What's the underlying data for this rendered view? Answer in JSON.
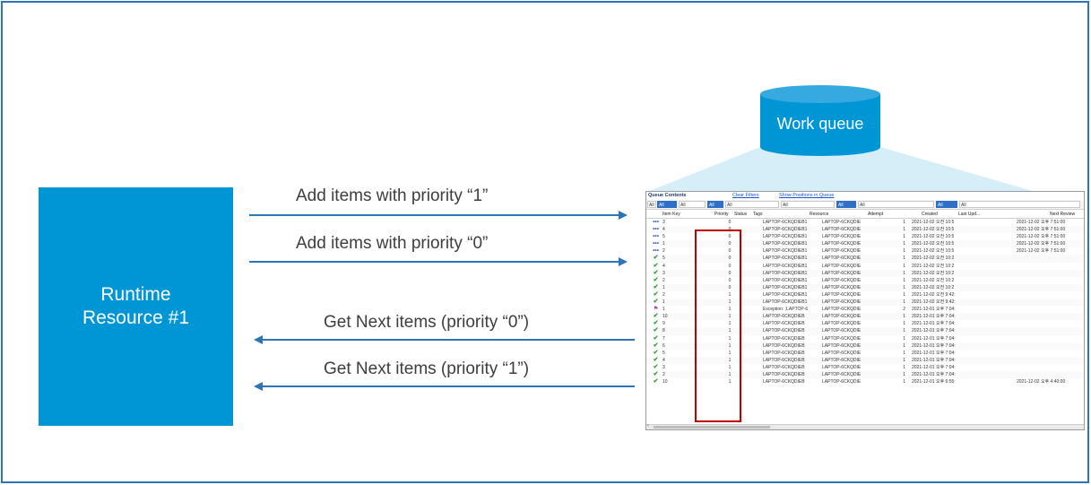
{
  "runtime_box": {
    "line1": "Runtime",
    "line2": "Resource #1"
  },
  "arrows": {
    "add1": "Add items with priority “1”",
    "add0": "Add items with priority “0”",
    "get0": "Get Next items  (priority “0”)",
    "get1": "Get Next items  (priority “1”)"
  },
  "cylinder": {
    "label": "Work queue"
  },
  "queue": {
    "title": "Queue Contents",
    "clear_filters": "Clear Filters",
    "show_positions": "Show Positions in Queue",
    "filters": [
      "All",
      "All",
      "All",
      "All",
      "All",
      "All",
      "All",
      "All",
      "All",
      "All",
      "All"
    ],
    "columns": {
      "item_key": "Item Key",
      "priority": "Priority",
      "status": "Status",
      "tags": "Tags",
      "resource": "Resource",
      "attempt": "Attempt",
      "created": "Created",
      "last_updated": "Last Upd...",
      "next_review": "Next Review"
    },
    "rows": [
      {
        "icon": "dots",
        "key": "3",
        "priority": "0",
        "tags": "LAPTOP-6CKQDIEB1",
        "resource": "LAPTOP-6CKQDIE",
        "attempt": "1",
        "created": "2021-12-02 오전 10:5",
        "next_review": "2021-12-02 오후 7:51:00"
      },
      {
        "icon": "dots",
        "key": "4",
        "priority": "0",
        "tags": "LAPTOP-6CKQDIEB1",
        "resource": "LAPTOP-6CKQDIE",
        "attempt": "1",
        "created": "2021-12-02 오전 10:5",
        "next_review": "2021-12-02 오후 7:51:00"
      },
      {
        "icon": "dots",
        "key": "5",
        "priority": "0",
        "tags": "LAPTOP-6CKQDIEB1",
        "resource": "LAPTOP-6CKQDIE",
        "attempt": "1",
        "created": "2021-12-02 오전 10:5",
        "next_review": "2021-12-02 오후 7:51:00"
      },
      {
        "icon": "dots",
        "key": "1",
        "priority": "0",
        "tags": "LAPTOP-6CKQDIEB1",
        "resource": "LAPTOP-6CKQDIE",
        "attempt": "1",
        "created": "2021-12-02 오전 10:5",
        "next_review": "2021-12-02 오후 7:51:00"
      },
      {
        "icon": "dots",
        "key": "2",
        "priority": "0",
        "tags": "LAPTOP-6CKQDIEB1",
        "resource": "LAPTOP-6CKQDIE",
        "attempt": "1",
        "created": "2021-12-02 오전 10:5",
        "next_review": "2021-12-02 오후 7:51:00"
      },
      {
        "icon": "check",
        "key": "5",
        "priority": "0",
        "tags": "LAPTOP-6CKQDIEB1",
        "resource": "LAPTOP-6CKQDIE",
        "attempt": "1",
        "created": "2021-12-02 오전 10:2",
        "next_review": ""
      },
      {
        "icon": "check",
        "key": "4",
        "priority": "0",
        "tags": "LAPTOP-6CKQDIEB1",
        "resource": "LAPTOP-6CKQDIE",
        "attempt": "1",
        "created": "2021-12-02 오전 10:2",
        "next_review": ""
      },
      {
        "icon": "check",
        "key": "3",
        "priority": "0",
        "tags": "LAPTOP-6CKQDIEB1",
        "resource": "LAPTOP-6CKQDIE",
        "attempt": "1",
        "created": "2021-12-02 오전 10:2",
        "next_review": ""
      },
      {
        "icon": "check",
        "key": "2",
        "priority": "0",
        "tags": "LAPTOP-6CKQDIEB1",
        "resource": "LAPTOP-6CKQDIE",
        "attempt": "1",
        "created": "2021-12-02 오전 10:2",
        "next_review": ""
      },
      {
        "icon": "check",
        "key": "1",
        "priority": "0",
        "tags": "LAPTOP-6CKQDIEB1",
        "resource": "LAPTOP-6CKQDIE",
        "attempt": "1",
        "created": "2021-12-02 오전 10:2",
        "next_review": ""
      },
      {
        "icon": "check",
        "key": "2",
        "priority": "1",
        "tags": "LAPTOP-6CKQDIEB1",
        "resource": "LAPTOP-6CKQDIE",
        "attempt": "1",
        "created": "2021-12-02 오전 9:42:",
        "next_review": ""
      },
      {
        "icon": "check",
        "key": "1",
        "priority": "1",
        "tags": "LAPTOP-6CKQDIEB1",
        "resource": "LAPTOP-6CKQDIE",
        "attempt": "1",
        "created": "2021-12-02 오전 9:42:",
        "next_review": ""
      },
      {
        "icon": "flag",
        "key": "1",
        "priority": "1",
        "tags": "Exception: ;LAPTOP-6",
        "resource": "LAPTOP-6CKQDIE",
        "attempt": "2",
        "created": "2021-12-01 오후 7:04:",
        "next_review": ""
      },
      {
        "icon": "check",
        "key": "10",
        "priority": "1",
        "tags": "LAPTOP-6CKQDIEB",
        "resource": "LAPTOP-6CKQDIE",
        "attempt": "1",
        "created": "2021-12-01 오후 7:04:",
        "next_review": ""
      },
      {
        "icon": "check",
        "key": "9",
        "priority": "1",
        "tags": "LAPTOP-6CKQDIEB",
        "resource": "LAPTOP-6CKQDIE",
        "attempt": "1",
        "created": "2021-12-01 오후 7:04:",
        "next_review": ""
      },
      {
        "icon": "check",
        "key": "8",
        "priority": "1",
        "tags": "LAPTOP-6CKQDIEB",
        "resource": "LAPTOP-6CKQDIE",
        "attempt": "1",
        "created": "2021-12-01 오후 7:04:",
        "next_review": ""
      },
      {
        "icon": "check",
        "key": "7",
        "priority": "1",
        "tags": "LAPTOP-6CKQDIEB",
        "resource": "LAPTOP-6CKQDIE",
        "attempt": "1",
        "created": "2021-12-01 오후 7:04:",
        "next_review": ""
      },
      {
        "icon": "check",
        "key": "6",
        "priority": "1",
        "tags": "LAPTOP-6CKQDIEB",
        "resource": "LAPTOP-6CKQDIE",
        "attempt": "1",
        "created": "2021-12-01 오후 7:04:",
        "next_review": ""
      },
      {
        "icon": "check",
        "key": "5",
        "priority": "1",
        "tags": "LAPTOP-6CKQDIEB",
        "resource": "LAPTOP-6CKQDIE",
        "attempt": "1",
        "created": "2021-12-01 오후 7:04:",
        "next_review": ""
      },
      {
        "icon": "check",
        "key": "4",
        "priority": "1",
        "tags": "LAPTOP-6CKQDIEB",
        "resource": "LAPTOP-6CKQDIE",
        "attempt": "1",
        "created": "2021-12-01 오후 7:04:",
        "next_review": ""
      },
      {
        "icon": "check",
        "key": "3",
        "priority": "1",
        "tags": "LAPTOP-6CKQDIEB",
        "resource": "LAPTOP-6CKQDIE",
        "attempt": "1",
        "created": "2021-12-01 오후 7:04:",
        "next_review": ""
      },
      {
        "icon": "check",
        "key": "2",
        "priority": "1",
        "tags": "LAPTOP-6CKQDIEB",
        "resource": "LAPTOP-6CKQDIE",
        "attempt": "1",
        "created": "2021-12-01 오후 7:04:",
        "next_review": ""
      },
      {
        "icon": "check",
        "key": "10",
        "priority": "1",
        "tags": "LAPTOP-6CKQDIEB",
        "resource": "LAPTOP-6CKQDIE",
        "attempt": "1",
        "created": "2021-12-01 오후 6:55:",
        "next_review": "2021-12-02 오후 4:40:00"
      }
    ]
  },
  "colors": {
    "accent": "#0096d6",
    "frame": "#2e75b6",
    "highlight": "#c00000",
    "cylinder_top": "#36a9e1",
    "cone": "#d5eef8"
  }
}
